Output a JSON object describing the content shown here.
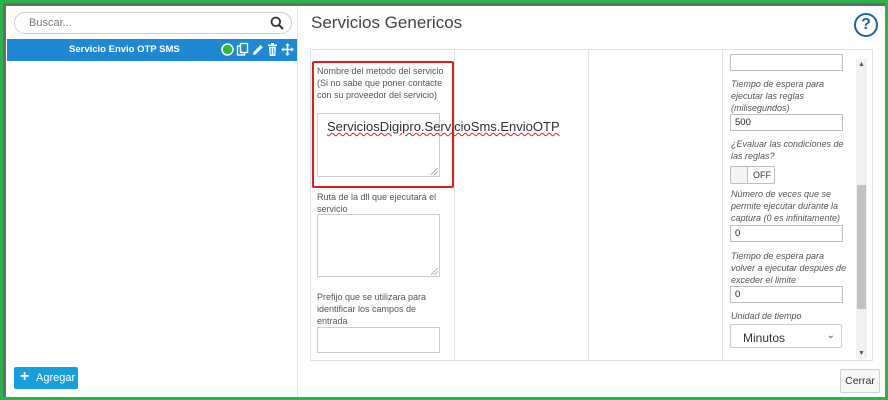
{
  "search": {
    "placeholder": "Buscar..."
  },
  "services": [
    {
      "label": "Servicio Envio OTP SMS"
    }
  ],
  "left_footer": {
    "add_label": "Agregar"
  },
  "header": {
    "title": "Servicios Genericos",
    "help_glyph": "?"
  },
  "form": {
    "method_name_label": "Nombre del metodo del servicio (Si no sabe que poner contacte con su proveedor del servicio)",
    "method_name_value": "ServiciosDigipro.ServicioSms.EnvioOTP",
    "dll_path_label": "Ruta de la dll que ejecutará el servicio",
    "prefix_label": "Prefijo que se utilizara para identificar los campos de entrada",
    "rules_wait_label": "Tiempo de espera para ejecutar las reglas (milisegundos)",
    "rules_wait_value": "500",
    "evaluate_rules_label": "¿Evaluar las condiciones de las reglas?",
    "evaluate_rules_toggle": "OFF",
    "retries_label": "Número de veces que se permite ejecutar durante la captura (0 es infinitamente)",
    "retries_value": "0",
    "retry_wait_label": "Tiempo de espera para volver a ejecutar despues de exceder el limite",
    "retry_wait_value": "0",
    "time_unit_label": "Unidad de tiempo",
    "time_unit_value": "Minutos"
  },
  "footer": {
    "close_label": "Cerrar"
  },
  "colors": {
    "accent": "#1f88d4",
    "highlight": "#e51b1b",
    "frame": "#2bb34a",
    "add_button": "#16a0db"
  },
  "icons": [
    "search-icon",
    "status-circle-icon",
    "copy-icon",
    "edit-icon",
    "trash-icon",
    "move-icon",
    "plus-icon",
    "help-icon",
    "chevron-down-icon"
  ]
}
